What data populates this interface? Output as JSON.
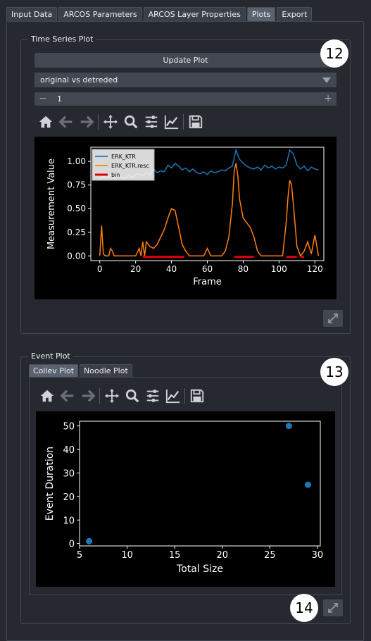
{
  "tabs": [
    "Input Data",
    "ARCOS Parameters",
    "ARCOS Layer Properties",
    "Plots",
    "Export"
  ],
  "active_tab": 3,
  "ts_group": {
    "title": "Time Series Plot",
    "update_label": "Update Plot",
    "dropdown_value": "original vs detreded",
    "spin_minus": "−",
    "spin_value": "1",
    "spin_plus": "+"
  },
  "toolbar_icons": [
    "home-icon",
    "back-arrow-icon",
    "forward-arrow-icon",
    "pan-icon",
    "zoom-icon",
    "configure-subplots-icon",
    "edit-axis-icon",
    "save-icon"
  ],
  "ev_group": {
    "title": "Event Plot",
    "subtabs": [
      "Collev Plot",
      "Noodle Plot"
    ]
  },
  "badges": {
    "b12": "12",
    "b13": "13",
    "b14": "14"
  },
  "chart_data": [
    {
      "type": "line",
      "xlabel": "Frame",
      "ylabel": "Measurement Value",
      "xlim": [
        -5,
        125
      ],
      "ylim": [
        -0.05,
        1.15
      ],
      "xticks": [
        0,
        20,
        40,
        60,
        80,
        100,
        120
      ],
      "yticks": [
        "0.00",
        "0.25",
        "0.50",
        "0.75",
        "1.00"
      ],
      "legend_position": "upper-left",
      "series": [
        {
          "name": "ERK_KTR",
          "color": "#1f77b4",
          "x": [
            0,
            2,
            4,
            6,
            8,
            10,
            12,
            14,
            16,
            18,
            20,
            22,
            24,
            26,
            28,
            30,
            32,
            34,
            36,
            38,
            40,
            42,
            44,
            46,
            48,
            50,
            52,
            54,
            56,
            58,
            60,
            62,
            64,
            66,
            68,
            70,
            72,
            74,
            76,
            78,
            80,
            82,
            84,
            86,
            88,
            90,
            92,
            94,
            96,
            98,
            100,
            102,
            104,
            106,
            108,
            110,
            112,
            114,
            116,
            118,
            120,
            122
          ],
          "values": [
            0.82,
            0.84,
            0.83,
            0.85,
            0.82,
            0.84,
            0.83,
            0.82,
            0.85,
            0.83,
            0.86,
            0.87,
            0.85,
            0.88,
            0.86,
            0.92,
            0.88,
            0.9,
            0.89,
            0.96,
            0.93,
            0.98,
            0.95,
            0.91,
            0.93,
            0.89,
            0.92,
            0.88,
            0.87,
            0.89,
            0.86,
            0.9,
            0.88,
            0.89,
            0.91,
            0.9,
            0.93,
            0.95,
            1.12,
            1.02,
            0.98,
            0.95,
            0.93,
            0.92,
            0.94,
            0.91,
            0.96,
            0.93,
            0.95,
            0.92,
            0.94,
            0.93,
            0.96,
            1.12,
            1.08,
            0.96,
            0.92,
            0.95,
            0.9,
            0.94,
            0.92,
            0.91
          ]
        },
        {
          "name": "ERK_KTR.resc",
          "color": "#ff7f0e",
          "x": [
            0,
            1,
            2,
            3,
            4,
            5,
            6,
            7,
            8,
            10,
            12,
            14,
            16,
            18,
            20,
            22,
            23,
            24,
            25,
            26,
            28,
            30,
            32,
            34,
            36,
            38,
            40,
            42,
            44,
            46,
            48,
            50,
            52,
            54,
            56,
            58,
            60,
            62,
            64,
            66,
            68,
            70,
            72,
            74,
            75,
            76,
            77,
            78,
            80,
            82,
            84,
            86,
            88,
            90,
            92,
            94,
            96,
            98,
            100,
            102,
            104,
            105,
            106,
            107,
            108,
            110,
            112,
            114,
            116,
            118,
            120,
            122
          ],
          "values": [
            0.0,
            0.32,
            0.02,
            0.0,
            0.0,
            0.0,
            0.08,
            0.05,
            0.0,
            0.0,
            0.0,
            0.0,
            0.0,
            0.0,
            0.0,
            0.08,
            0.0,
            0.15,
            0.0,
            0.15,
            0.1,
            0.08,
            0.12,
            0.2,
            0.28,
            0.4,
            0.5,
            0.48,
            0.3,
            0.12,
            0.05,
            0.0,
            0.0,
            0.0,
            0.0,
            0.0,
            0.08,
            0.0,
            0.0,
            0.0,
            0.0,
            0.05,
            0.2,
            0.55,
            0.9,
            0.98,
            0.85,
            0.6,
            0.4,
            0.35,
            0.3,
            0.2,
            0.05,
            0.0,
            0.0,
            0.0,
            0.0,
            0.0,
            0.0,
            0.0,
            0.35,
            0.62,
            0.8,
            0.75,
            0.55,
            0.1,
            0.0,
            0.05,
            0.15,
            0.02,
            0.22,
            0.0
          ]
        },
        {
          "name": "bin",
          "color": "#e00000",
          "segments": [
            [
              24,
              47
            ],
            [
              75,
              86
            ],
            [
              104,
              110
            ],
            [
              112,
              114
            ]
          ],
          "y": -0.01
        }
      ]
    },
    {
      "type": "scatter",
      "xlabel": "Total Size",
      "ylabel": "Event Duration",
      "xlim": [
        5,
        30.3
      ],
      "ylim": [
        -1,
        52
      ],
      "xticks": [
        5,
        10,
        15,
        20,
        25,
        30
      ],
      "yticks": [
        0,
        10,
        20,
        30,
        40,
        50
      ],
      "color": "#1f77b4",
      "x": [
        6,
        27,
        29
      ],
      "y": [
        1,
        50,
        25
      ]
    }
  ]
}
